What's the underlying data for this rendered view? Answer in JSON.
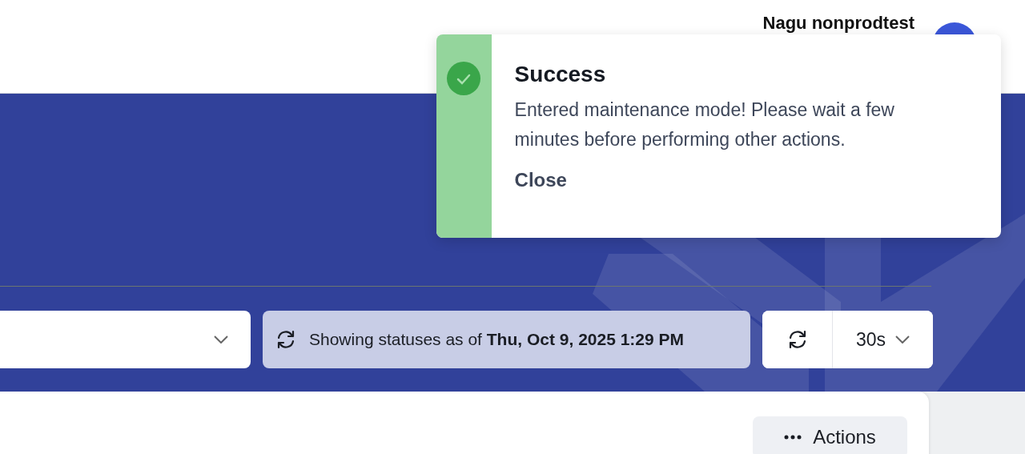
{
  "header": {
    "user_name": "Nagu nonprodtest"
  },
  "toast": {
    "title": "Success",
    "message": "Entered maintenance mode! Please wait a few minutes before performing other actions.",
    "action": "Close"
  },
  "toolbar": {
    "status": "Showing statuses as of **Thu, Oct 9, 2025 1:29 PM**",
    "interval": "30s"
  },
  "card": {
    "actions_button": "Actions"
  }
}
